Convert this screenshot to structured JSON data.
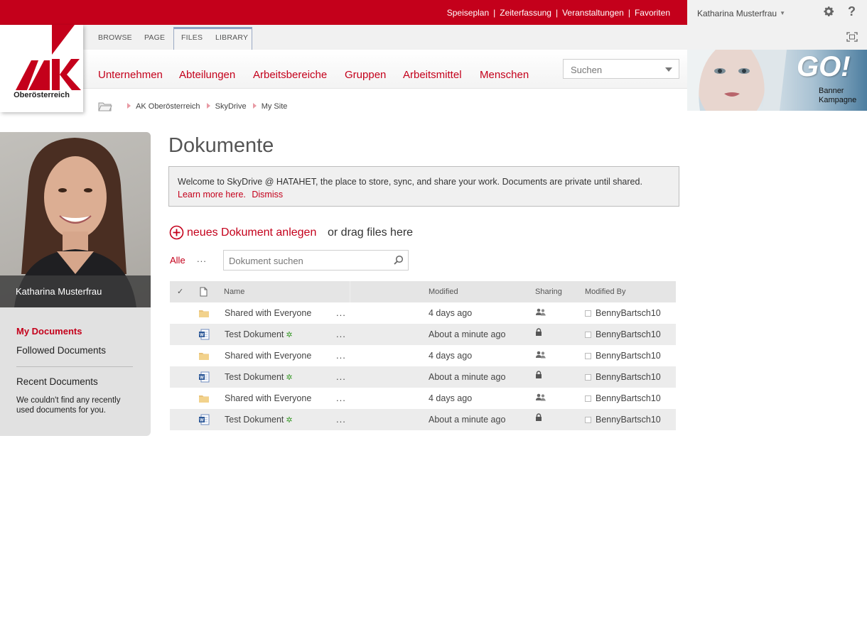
{
  "topbar": {
    "links": [
      "Speiseplan",
      "Zeiterfassung",
      "Veranstaltungen",
      "Favoriten"
    ],
    "separator": "|",
    "user": "Katharina Musterfrau",
    "help": "?"
  },
  "ribbon": {
    "tabs": [
      "BROWSE",
      "PAGE",
      "FILES",
      "LIBRARY"
    ]
  },
  "logo": {
    "text": "Oberösterreich"
  },
  "nav": {
    "items": [
      "Unternehmen",
      "Abteilungen",
      "Arbeitsbereiche",
      "Gruppen",
      "Arbeitsmittel",
      "Menschen"
    ],
    "search_placeholder": "Suchen"
  },
  "banner": {
    "headline": "GO!",
    "label_line1": "Banner",
    "label_line2": "Kampagne"
  },
  "breadcrumb": [
    "AK Oberösterreich",
    "SkyDrive",
    "My Site"
  ],
  "profile": {
    "name": "Katharina Musterfrau",
    "links": {
      "my_documents": "My Documents",
      "followed_documents": "Followed Documents",
      "recent_documents": "Recent Documents",
      "recent_empty": "We couldn't find any recently used documents for you."
    }
  },
  "main": {
    "title": "Dokumente",
    "welcome_text": "Welcome to SkyDrive @ HATAHET, the place to store, sync, and share your work. Documents are private until shared.",
    "learn_more": "Learn more here.",
    "dismiss": "Dismiss",
    "new_document": "neues Dokument anlegen",
    "drag_text": "or drag files here",
    "view_all": "Alle",
    "view_more": "...",
    "search_placeholder": "Dokument suchen"
  },
  "table": {
    "columns": {
      "name": "Name",
      "modified": "Modified",
      "sharing": "Sharing",
      "modified_by": "Modified By"
    },
    "rows": [
      {
        "type": "folder",
        "name": "Shared with Everyone",
        "new": "",
        "dots": "...",
        "modified": "4 days ago",
        "sharing": "shared",
        "modified_by": "BennyBartsch10"
      },
      {
        "type": "word",
        "name": "Test Dokument",
        "new": "✲",
        "dots": "...",
        "modified": "About a minute ago",
        "sharing": "private",
        "modified_by": "BennyBartsch10"
      },
      {
        "type": "folder",
        "name": "Shared with Everyone",
        "new": "",
        "dots": "...",
        "modified": "4 days ago",
        "sharing": "shared",
        "modified_by": "BennyBartsch10"
      },
      {
        "type": "word",
        "name": "Test Dokument",
        "new": "✲",
        "dots": "...",
        "modified": "About a minute ago",
        "sharing": "private",
        "modified_by": "BennyBartsch10"
      },
      {
        "type": "folder",
        "name": "Shared with Everyone",
        "new": "",
        "dots": "...",
        "modified": "4 days ago",
        "sharing": "shared",
        "modified_by": "BennyBartsch10"
      },
      {
        "type": "word",
        "name": "Test Dokument",
        "new": "✲",
        "dots": "...",
        "modified": "About a minute ago",
        "sharing": "private",
        "modified_by": "BennyBartsch10"
      }
    ]
  },
  "colors": {
    "brand_red": "#c4001b",
    "ribbon_gray": "#f1f1f1",
    "row_alt": "#ececec",
    "new_green": "#3a9a2a"
  },
  "icons": {
    "gear": "gear-icon",
    "help": "help-icon",
    "focus": "focus-on-content-icon",
    "folder": "folder-icon",
    "word": "word-document-icon",
    "shared": "people-icon",
    "private": "lock-icon",
    "search": "magnifier-icon",
    "add": "plus-circle-icon"
  }
}
